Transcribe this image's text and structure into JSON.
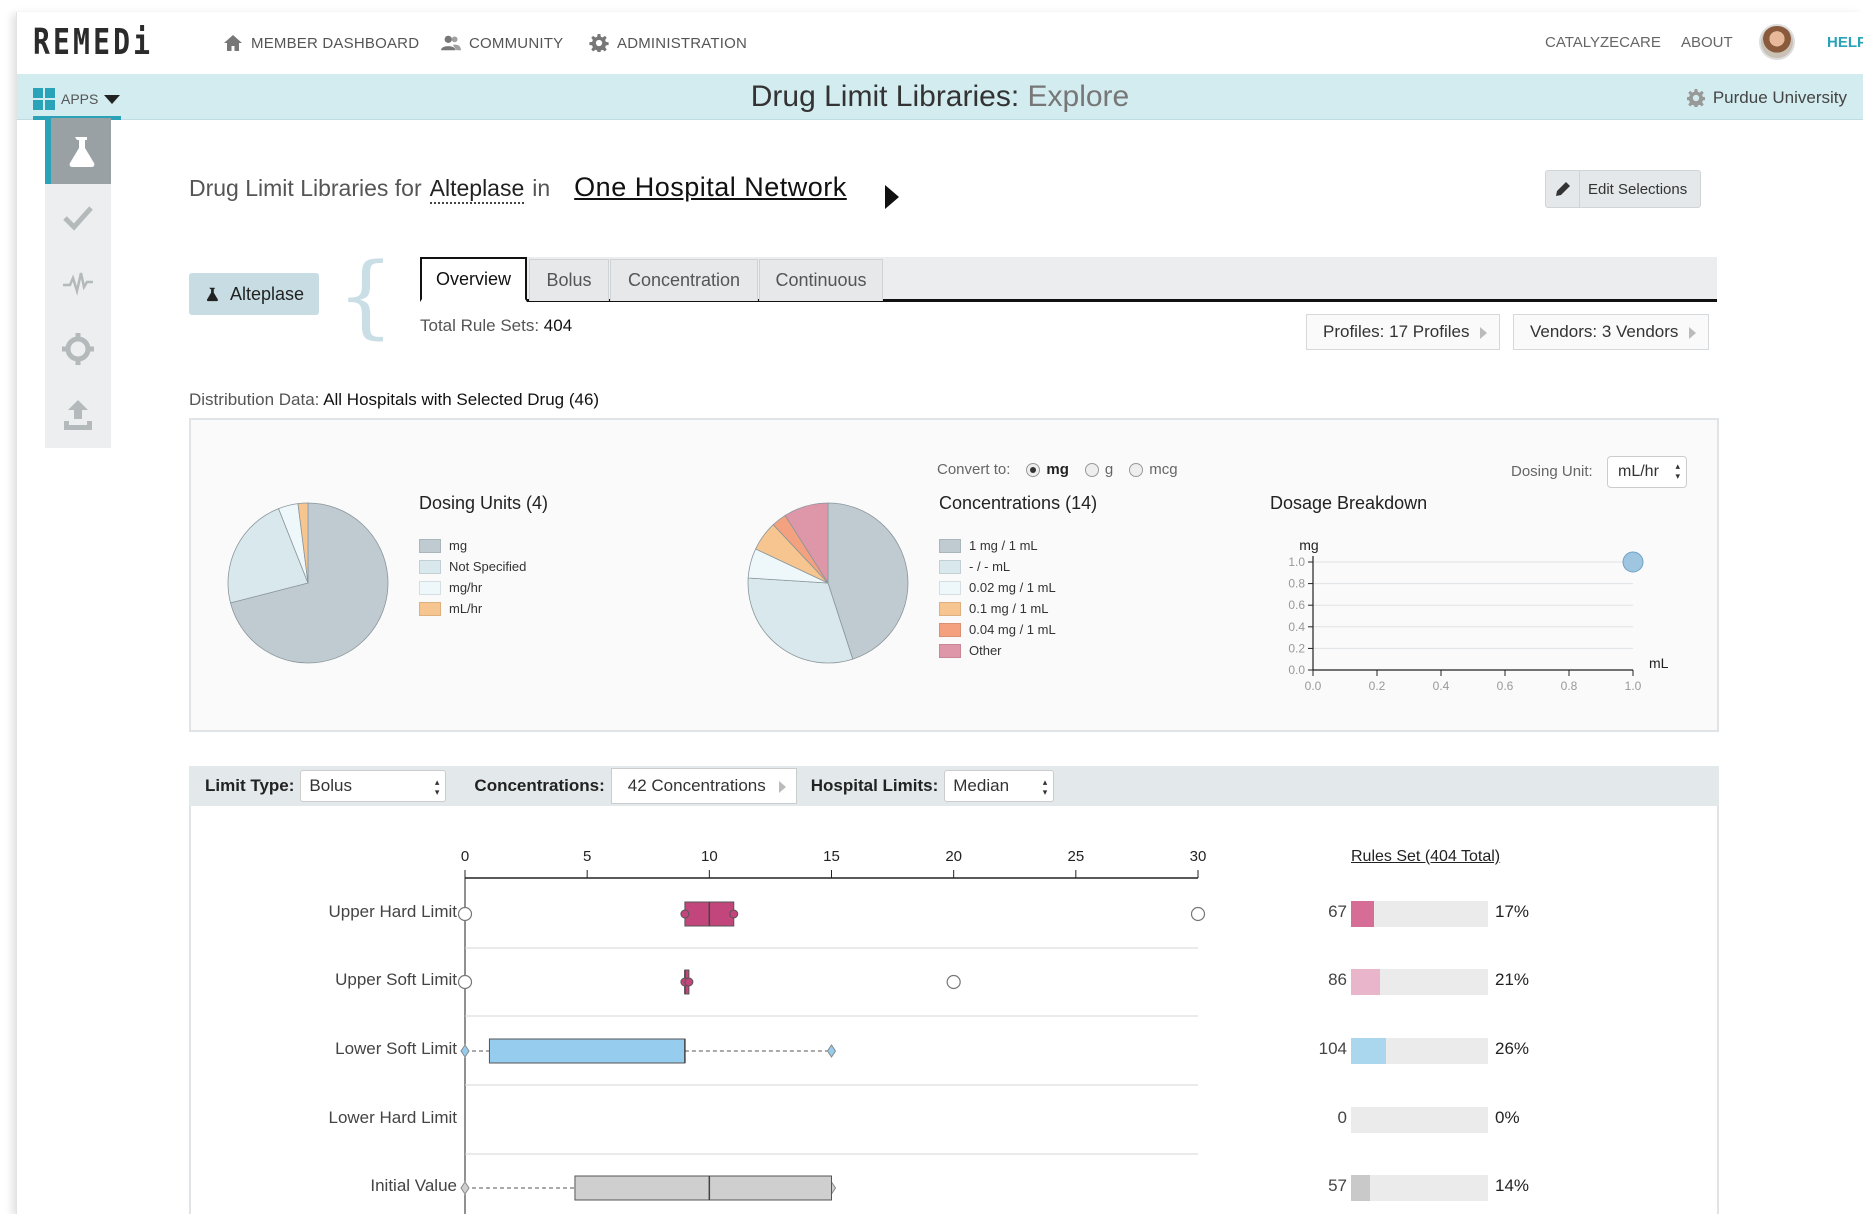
{
  "app": {
    "logo": "REMEDi",
    "nav": [
      {
        "label": "MEMBER DASHBOARD",
        "icon": "home-icon"
      },
      {
        "label": "COMMUNITY",
        "icon": "users-icon"
      },
      {
        "label": "ADMINISTRATION",
        "icon": "gear-icon"
      }
    ],
    "right_nav": [
      "CATALYZECARE",
      "ABOUT"
    ],
    "help": "HELP",
    "apps_label": "APPS",
    "page_title": "Drug Limit Libraries:",
    "page_subtitle": "Explore",
    "organization": "Purdue University"
  },
  "header": {
    "prefix": "Drug Limit Libraries for",
    "drug": "Alteplase",
    "in": "in",
    "network": "One Hospital Network",
    "edit_button": "Edit Selections"
  },
  "drug_chip": "Alteplase",
  "tabs": [
    "Overview",
    "Bolus",
    "Concentration",
    "Continuous"
  ],
  "total_rule_sets_label": "Total Rule Sets:",
  "total_rule_sets": "404",
  "profiles_pill": "Profiles: 17 Profiles",
  "vendors_pill": "Vendors: 3 Vendors",
  "distribution_label": "Distribution Data:",
  "distribution_value": "All Hospitals with Selected Drug (46)",
  "convert": {
    "label": "Convert to:",
    "options": [
      "mg",
      "g",
      "mcg"
    ],
    "selected": "mg"
  },
  "dosing_unit": {
    "label": "Dosing Unit:",
    "value": "mL/hr"
  },
  "filters": {
    "limit_type_label": "Limit Type:",
    "limit_type": "Bolus",
    "concentrations_label": "Concentrations:",
    "concentrations": "42 Concentrations",
    "hospital_limits_label": "Hospital Limits:",
    "hospital_limits": "Median"
  },
  "rules_set_header": "Rules Set (404 Total)",
  "chart_data": [
    {
      "type": "pie",
      "title": "Dosing Units (4)",
      "categories": [
        "mg",
        "Not Specified",
        "mg/hr",
        "mL/hr"
      ],
      "values": [
        71,
        23,
        4,
        2
      ],
      "colors": [
        "#bfcbd1",
        "#d9e8ed",
        "#eef8fa",
        "#f7c58f"
      ]
    },
    {
      "type": "pie",
      "title": "Concentrations (14)",
      "categories": [
        "1 mg / 1 mL",
        "- / - mL",
        "0.02 mg / 1 mL",
        "0.1 mg / 1 mL",
        "0.04 mg / 1 mL",
        "Other"
      ],
      "values": [
        45,
        31,
        6,
        6,
        3,
        9
      ],
      "colors": [
        "#bfcbd1",
        "#d9e8ed",
        "#eef8fa",
        "#f7c58f",
        "#f4a180",
        "#de97a8"
      ]
    },
    {
      "type": "scatter",
      "title": "Dosage Breakdown",
      "xlabel": "mL",
      "ylabel": "mg",
      "xlim": [
        0,
        1
      ],
      "ylim": [
        0,
        1
      ],
      "xticks": [
        "0.0",
        "0.2",
        "0.4",
        "0.6",
        "0.8",
        "1.0"
      ],
      "yticks": [
        "0.0",
        "0.2",
        "0.4",
        "0.6",
        "0.8",
        "1.0"
      ],
      "points": [
        {
          "x": 1.0,
          "y": 1.0
        }
      ],
      "color": "#9ec6e0",
      "grid": true
    },
    {
      "type": "boxplot",
      "xlim": [
        0,
        30
      ],
      "xticks": [
        0,
        5,
        10,
        15,
        20,
        25,
        30
      ],
      "rows": [
        {
          "label": "Upper Hard Limit",
          "color": "#c2467b",
          "whisker_low": null,
          "q1": 9,
          "median": 10,
          "q3": 11,
          "whisker_high": null,
          "outliers": [
            0,
            30
          ]
        },
        {
          "label": "Upper Soft Limit",
          "color": "#c2467b",
          "whisker_low": null,
          "q1": 9,
          "median": 9,
          "q3": 9,
          "whisker_high": null,
          "outliers": [
            0,
            20
          ]
        },
        {
          "label": "Lower Soft Limit",
          "color": "#96cced",
          "whisker_low": 0,
          "q1": 1,
          "median": 9,
          "q3": 9,
          "whisker_high": 15,
          "outliers": []
        },
        {
          "label": "Lower Hard Limit",
          "color": "#96cced",
          "whisker_low": null,
          "q1": null,
          "median": null,
          "q3": null,
          "whisker_high": null,
          "outliers": []
        },
        {
          "label": "Initial Value",
          "color": "#cfcfcf",
          "whisker_low": 0,
          "q1": 4.5,
          "median": 10,
          "q3": 15,
          "whisker_high": 15,
          "outliers": []
        }
      ]
    },
    {
      "type": "bar",
      "title": "Rules Set (404 Total)",
      "categories": [
        "Upper Hard Limit",
        "Upper Soft Limit",
        "Lower Soft Limit",
        "Lower Hard Limit",
        "Initial Value"
      ],
      "values": [
        67,
        86,
        104,
        0,
        57
      ],
      "percent_labels": [
        "17%",
        "21%",
        "26%",
        "0%",
        "14%"
      ],
      "colors": [
        "#d66d97",
        "#e8b5cb",
        "#aad6ee",
        "#ebebeb",
        "#c9c9c9"
      ]
    }
  ]
}
